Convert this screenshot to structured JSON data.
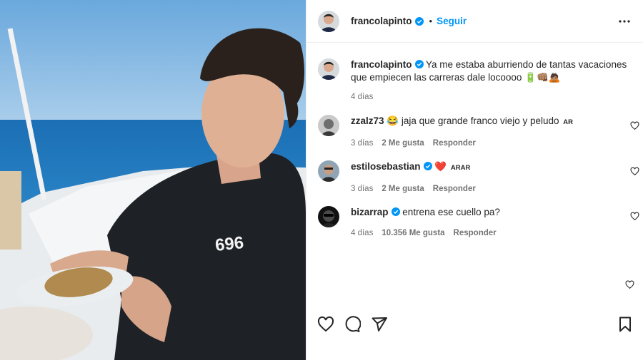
{
  "post": {
    "author": "francolapinto",
    "follow_label": "Seguir",
    "separator": "•",
    "more_icon": "more-horizontal-icon",
    "verified_color": "#0095f6",
    "accent": "#0095f6"
  },
  "caption": {
    "username": "francolapinto",
    "text": "Ya me estaba aburriendo de tantas vacaciones que empiecen las carreras dale locoooo 🔋👊🏽🙇🏽",
    "time": "4 días"
  },
  "comments": [
    {
      "username": "zzalz73",
      "prefix_emoji": "😂",
      "text": "jaja que grande franco viejo y peludo",
      "suffix": "AR",
      "time": "3 días",
      "likes": "2 Me gusta",
      "reply_label": "Responder"
    },
    {
      "username": "estilosebastian",
      "prefix_emoji": "❤️",
      "text": "",
      "suffix": "ARAR",
      "time": "3 días",
      "likes": "2 Me gusta",
      "reply_label": "Responder"
    },
    {
      "username": "bizarrap",
      "prefix_emoji": "",
      "text": "entrena ese cuello pa?",
      "suffix": "",
      "time": "4 días",
      "likes": "10.356 Me gusta",
      "reply_label": "Responder"
    }
  ],
  "photo": {
    "shirt_print": "696"
  },
  "actions": {
    "icons": [
      "heart-icon",
      "comment-icon",
      "share-icon",
      "bookmark-icon"
    ]
  }
}
